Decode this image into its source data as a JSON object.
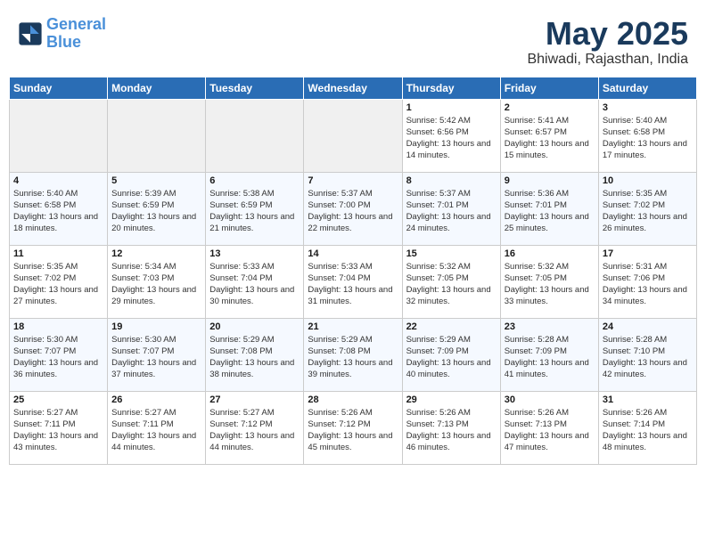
{
  "header": {
    "logo_line1": "General",
    "logo_line2": "Blue",
    "month": "May 2025",
    "location": "Bhiwadi, Rajasthan, India"
  },
  "weekdays": [
    "Sunday",
    "Monday",
    "Tuesday",
    "Wednesday",
    "Thursday",
    "Friday",
    "Saturday"
  ],
  "weeks": [
    [
      {
        "day": "",
        "empty": true
      },
      {
        "day": "",
        "empty": true
      },
      {
        "day": "",
        "empty": true
      },
      {
        "day": "",
        "empty": true
      },
      {
        "day": "1",
        "sunrise": "5:42 AM",
        "sunset": "6:56 PM",
        "daylight": "13 hours and 14 minutes."
      },
      {
        "day": "2",
        "sunrise": "5:41 AM",
        "sunset": "6:57 PM",
        "daylight": "13 hours and 15 minutes."
      },
      {
        "day": "3",
        "sunrise": "5:40 AM",
        "sunset": "6:58 PM",
        "daylight": "13 hours and 17 minutes."
      }
    ],
    [
      {
        "day": "4",
        "sunrise": "5:40 AM",
        "sunset": "6:58 PM",
        "daylight": "13 hours and 18 minutes."
      },
      {
        "day": "5",
        "sunrise": "5:39 AM",
        "sunset": "6:59 PM",
        "daylight": "13 hours and 20 minutes."
      },
      {
        "day": "6",
        "sunrise": "5:38 AM",
        "sunset": "6:59 PM",
        "daylight": "13 hours and 21 minutes."
      },
      {
        "day": "7",
        "sunrise": "5:37 AM",
        "sunset": "7:00 PM",
        "daylight": "13 hours and 22 minutes."
      },
      {
        "day": "8",
        "sunrise": "5:37 AM",
        "sunset": "7:01 PM",
        "daylight": "13 hours and 24 minutes."
      },
      {
        "day": "9",
        "sunrise": "5:36 AM",
        "sunset": "7:01 PM",
        "daylight": "13 hours and 25 minutes."
      },
      {
        "day": "10",
        "sunrise": "5:35 AM",
        "sunset": "7:02 PM",
        "daylight": "13 hours and 26 minutes."
      }
    ],
    [
      {
        "day": "11",
        "sunrise": "5:35 AM",
        "sunset": "7:02 PM",
        "daylight": "13 hours and 27 minutes."
      },
      {
        "day": "12",
        "sunrise": "5:34 AM",
        "sunset": "7:03 PM",
        "daylight": "13 hours and 29 minutes."
      },
      {
        "day": "13",
        "sunrise": "5:33 AM",
        "sunset": "7:04 PM",
        "daylight": "13 hours and 30 minutes."
      },
      {
        "day": "14",
        "sunrise": "5:33 AM",
        "sunset": "7:04 PM",
        "daylight": "13 hours and 31 minutes."
      },
      {
        "day": "15",
        "sunrise": "5:32 AM",
        "sunset": "7:05 PM",
        "daylight": "13 hours and 32 minutes."
      },
      {
        "day": "16",
        "sunrise": "5:32 AM",
        "sunset": "7:05 PM",
        "daylight": "13 hours and 33 minutes."
      },
      {
        "day": "17",
        "sunrise": "5:31 AM",
        "sunset": "7:06 PM",
        "daylight": "13 hours and 34 minutes."
      }
    ],
    [
      {
        "day": "18",
        "sunrise": "5:30 AM",
        "sunset": "7:07 PM",
        "daylight": "13 hours and 36 minutes."
      },
      {
        "day": "19",
        "sunrise": "5:30 AM",
        "sunset": "7:07 PM",
        "daylight": "13 hours and 37 minutes."
      },
      {
        "day": "20",
        "sunrise": "5:29 AM",
        "sunset": "7:08 PM",
        "daylight": "13 hours and 38 minutes."
      },
      {
        "day": "21",
        "sunrise": "5:29 AM",
        "sunset": "7:08 PM",
        "daylight": "13 hours and 39 minutes."
      },
      {
        "day": "22",
        "sunrise": "5:29 AM",
        "sunset": "7:09 PM",
        "daylight": "13 hours and 40 minutes."
      },
      {
        "day": "23",
        "sunrise": "5:28 AM",
        "sunset": "7:09 PM",
        "daylight": "13 hours and 41 minutes."
      },
      {
        "day": "24",
        "sunrise": "5:28 AM",
        "sunset": "7:10 PM",
        "daylight": "13 hours and 42 minutes."
      }
    ],
    [
      {
        "day": "25",
        "sunrise": "5:27 AM",
        "sunset": "7:11 PM",
        "daylight": "13 hours and 43 minutes."
      },
      {
        "day": "26",
        "sunrise": "5:27 AM",
        "sunset": "7:11 PM",
        "daylight": "13 hours and 44 minutes."
      },
      {
        "day": "27",
        "sunrise": "5:27 AM",
        "sunset": "7:12 PM",
        "daylight": "13 hours and 44 minutes."
      },
      {
        "day": "28",
        "sunrise": "5:26 AM",
        "sunset": "7:12 PM",
        "daylight": "13 hours and 45 minutes."
      },
      {
        "day": "29",
        "sunrise": "5:26 AM",
        "sunset": "7:13 PM",
        "daylight": "13 hours and 46 minutes."
      },
      {
        "day": "30",
        "sunrise": "5:26 AM",
        "sunset": "7:13 PM",
        "daylight": "13 hours and 47 minutes."
      },
      {
        "day": "31",
        "sunrise": "5:26 AM",
        "sunset": "7:14 PM",
        "daylight": "13 hours and 48 minutes."
      }
    ]
  ]
}
